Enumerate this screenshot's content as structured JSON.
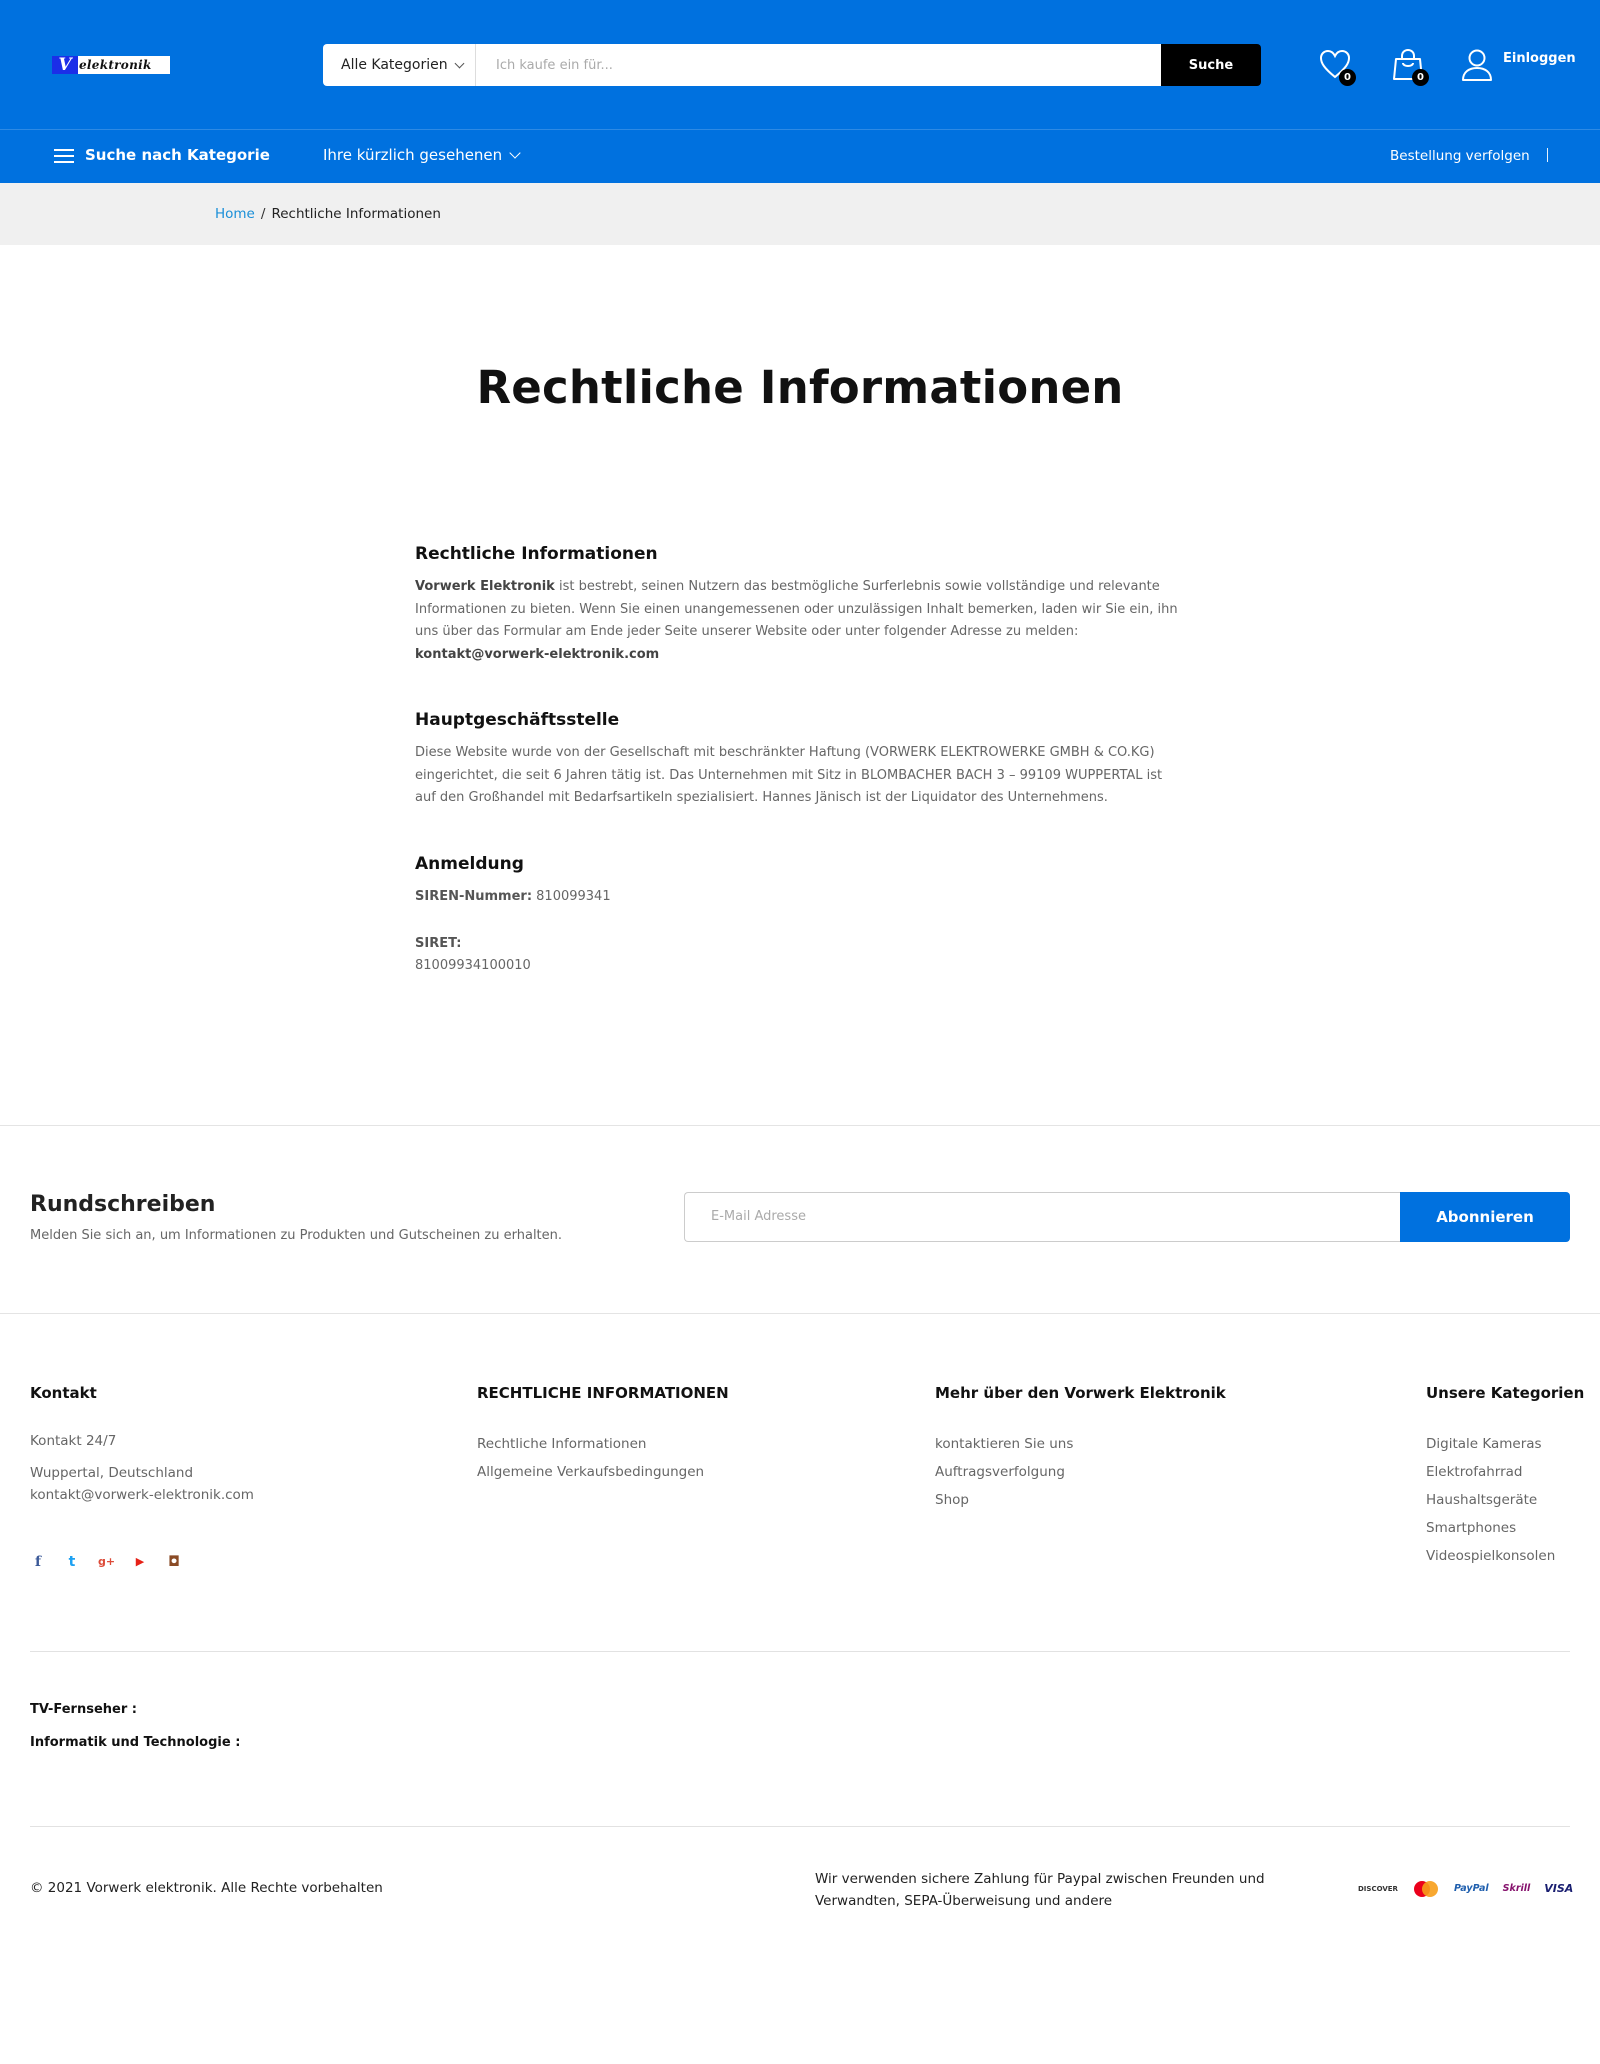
{
  "header": {
    "logo_letter": "V",
    "logo_word": "elektronik",
    "search": {
      "category": "Alle Kategorien",
      "placeholder": "Ich kaufe ein für...",
      "button": "Suche"
    },
    "wishlist_count": "0",
    "cart_count": "0",
    "login": "Einloggen",
    "accent_color": "#0071df"
  },
  "nav": {
    "by_category": "Suche nach Kategorie",
    "recently_viewed": "Ihre kürzlich gesehenen",
    "track_order": "Bestellung verfolgen"
  },
  "breadcrumb": {
    "home": "Home",
    "separator": "/",
    "current": "Rechtliche Informationen"
  },
  "page": {
    "title": "Rechtliche Informationen",
    "sections": {
      "legal": {
        "heading": "Rechtliche Informationen",
        "company": "Vorwerk Elektronik",
        "text": " ist bestrebt, seinen Nutzern das bestmögliche Surferlebnis sowie vollständige und relevante Informationen zu bieten. Wenn Sie einen unangemessenen oder unzulässigen Inhalt bemerken, laden wir Sie ein, ihn uns über das Formular am Ende jeder Seite unserer Website oder unter folgender Adresse zu melden: ",
        "email": "kontakt@vorwerk-elektronik.com"
      },
      "hq": {
        "heading": "Hauptgeschäftsstelle",
        "text": "Diese Website wurde von der Gesellschaft mit beschränkter Haftung (VORWERK ELEKTROWERKE GMBH & CO.KG) eingerichtet, die seit 6 Jahren tätig ist. Das Unternehmen mit Sitz in BLOMBACHER BACH 3 – 99109 WUPPERTAL ist auf den Großhandel mit Bedarfsartikeln spezialisiert. Hannes Jänisch ist der Liquidator des Unternehmens."
      },
      "registration": {
        "heading": "Anmeldung",
        "siren_label": "SIREN-Nummer:",
        "siren_value": " 810099341",
        "siret_label": "SIRET:",
        "siret_value": "81009934100010"
      }
    }
  },
  "newsletter": {
    "title": "Rundschreiben",
    "subtitle": "Melden Sie sich an, um Informationen zu Produkten und Gutscheinen zu erhalten.",
    "placeholder": "E-Mail Adresse",
    "button": "Abonnieren"
  },
  "footer": {
    "contact": {
      "heading": "Kontakt",
      "line1": "Kontakt 24/7",
      "line2": "Wuppertal, Deutschland",
      "line3": "kontakt@vorwerk-elektronik.com"
    },
    "legal": {
      "heading": "RECHTLICHE INFORMATIONEN",
      "links": [
        "Rechtliche Informationen",
        "Allgemeine Verkaufsbedingungen"
      ]
    },
    "more": {
      "heading": "Mehr über den Vorwerk Elektronik",
      "links": [
        "kontaktieren Sie uns",
        "Auftragsverfolgung",
        "Shop"
      ]
    },
    "categories": {
      "heading": "Unsere Kategorien",
      "links": [
        "Digitale Kameras",
        "Elektrofahrrad",
        "Haushaltsgeräte",
        "Smartphones",
        "Videospielkonsolen"
      ]
    },
    "social": {
      "facebook": "f",
      "twitter": "t",
      "googleplus": "g+",
      "youtube": "▶",
      "instagram": "◘"
    },
    "tags": [
      "TV-Fernseher :",
      "Informatik und Technologie :"
    ],
    "copyright": "© 2021 Vorwerk elektronik. Alle Rechte vorbehalten",
    "payment_text": "Wir verwenden sichere Zahlung für Paypal zwischen Freunden und Verwandten, SEPA-Überweisung und andere",
    "payment_logos": [
      "DISCOVER",
      "mastercard",
      "PayPal",
      "Skrill",
      "VISA"
    ]
  }
}
